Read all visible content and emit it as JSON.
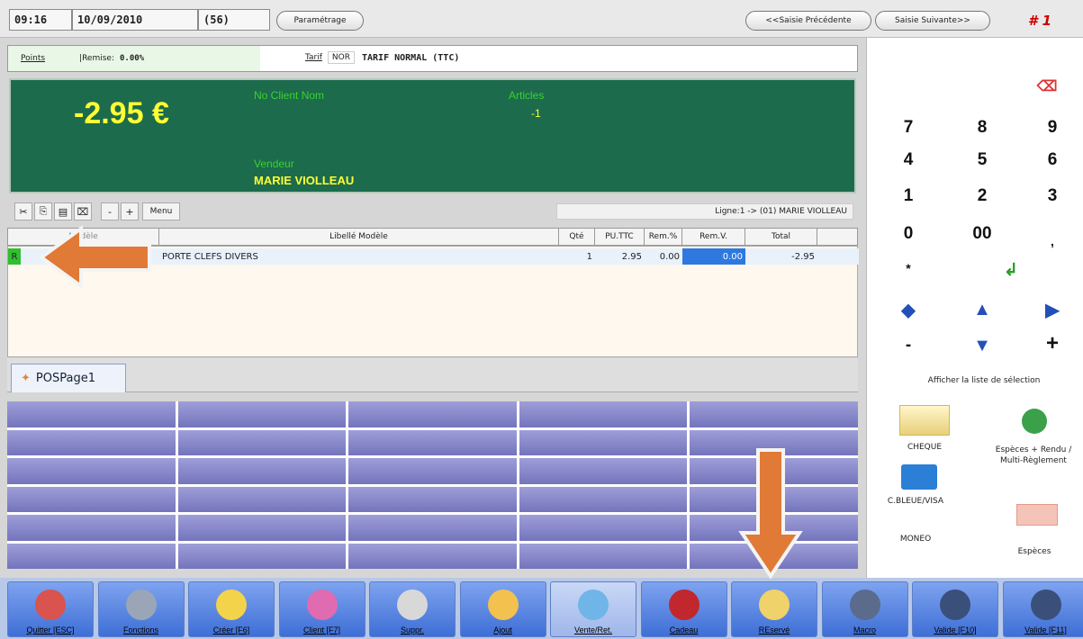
{
  "topbar": {
    "time": "09:16",
    "date": "10/09/2010",
    "count": "(56)",
    "param_label": "Paramétrage",
    "prev_label": "<<Saisie Précédente",
    "next_label": "Saisie Suivante>>",
    "ticket_no": "# 1"
  },
  "info": {
    "points_label": "Points",
    "remise_label": "|Remise:",
    "remise_value": "0.00%",
    "tarif_label": "Tarif",
    "tarif_code": "NOR",
    "tarif_name": "TARIF NORMAL (TTC)"
  },
  "display": {
    "amount": "-2.95 €",
    "client_label": "No Client Nom",
    "articles_label": "Articles",
    "articles_value": "-1",
    "vendeur_label": "Vendeur",
    "vendeur_value": "MARIE VIOLLEAU"
  },
  "toolbar": {
    "minus": "-",
    "plus": "+",
    "menu": "Menu",
    "ligne": "Ligne:1 -> (01) MARIE VIOLLEAU"
  },
  "grid": {
    "headers": [
      "Modèle",
      "Libellé Modèle",
      "Qté",
      "PU.TTC",
      "Rem.%",
      "Rem.V.",
      "Total"
    ],
    "rows": [
      {
        "code": "R",
        "libelle": "PORTE CLEFS DIVERS",
        "qte": "1",
        "pu": "2.95",
        "rem_pct": "0.00",
        "rem_v": "0.00",
        "total": "-2.95"
      }
    ]
  },
  "tab": {
    "label": "POSPage1"
  },
  "keypad": {
    "keys": [
      "7",
      "8",
      "9",
      "4",
      "5",
      "6",
      "1",
      "2",
      "3",
      "0",
      "00",
      ",",
      "*"
    ],
    "minus": "-",
    "plus": "+",
    "list_label": "Afficher la liste de sélection"
  },
  "payments": {
    "cheque": "CHEQUE",
    "especes_rendu": "Espèces + Rendu / Multi-Règlement",
    "cbleue": "C.BLEUE/VISA",
    "moneo": "MONEO",
    "especes": "Espèces"
  },
  "bottom_buttons": [
    {
      "label": "Quitter [ESC]",
      "color": "#d9534f"
    },
    {
      "label": "Fonctions",
      "color": "#9aa6b8"
    },
    {
      "label": "Créer [F6]",
      "color": "#f3d34a"
    },
    {
      "label": "Client [F7]",
      "color": "#e06bb0"
    },
    {
      "label": "Suppr.",
      "color": "#d8d8d8"
    },
    {
      "label": "Ajout",
      "color": "#f2c14e"
    },
    {
      "label": "Vente/Ret.",
      "color": "#6fb5e8"
    },
    {
      "label": "Cadeau",
      "color": "#c1272d"
    },
    {
      "label": "REservé",
      "color": "#f0d26a"
    },
    {
      "label": "Macro",
      "color": "#5a6b8c"
    },
    {
      "label": "Valide [F10]",
      "color": "#3a4f7a"
    },
    {
      "label": "Valide [F11]",
      "color": "#3a4f7a"
    }
  ]
}
